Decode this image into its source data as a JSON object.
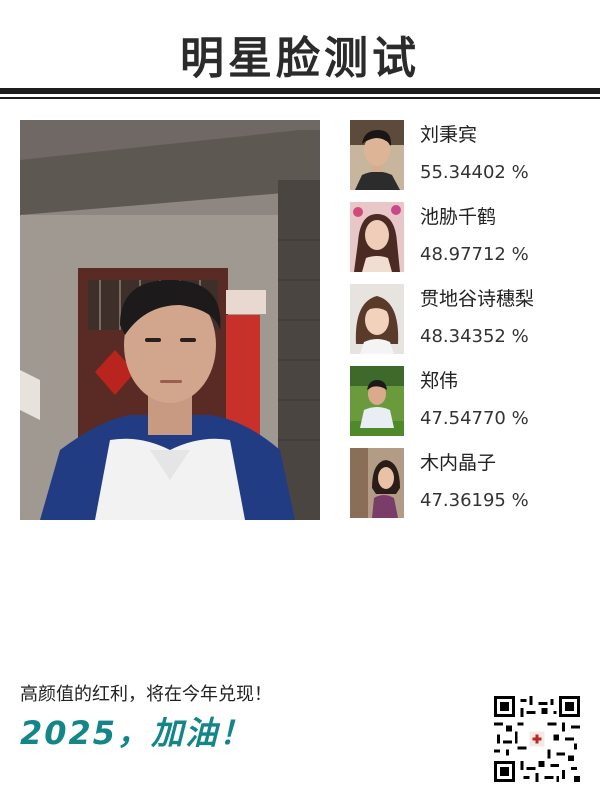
{
  "header": {
    "title": "明星脸测试"
  },
  "matches": [
    {
      "name": "刘秉宾",
      "score": "55.34402 %"
    },
    {
      "name": "池胁千鹤",
      "score": "48.97712 %"
    },
    {
      "name": "贯地谷诗穗梨",
      "score": "48.34352 %"
    },
    {
      "name": "郑伟",
      "score": "47.54770 %"
    },
    {
      "name": "木内晶子",
      "score": "47.36195 %"
    }
  ],
  "footer": {
    "slogan_line1": "高颜值的红利，将在今年兑现！",
    "slogan_line2": "2025，加油！"
  },
  "colors": {
    "accent": "#14868a",
    "rule": "#1e1e1e",
    "title": "#2b2b2b"
  },
  "icons": {
    "qr_code": "qr-code-icon"
  }
}
